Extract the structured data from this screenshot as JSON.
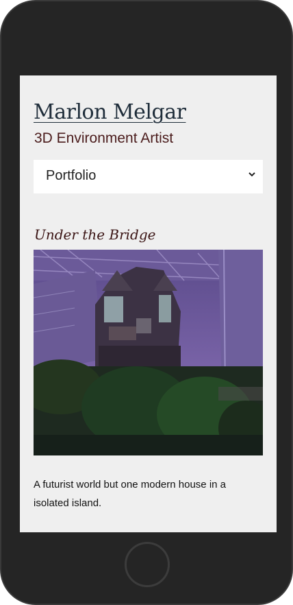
{
  "site": {
    "title": "Marlon Melgar",
    "subtitle": "3D Environment Artist"
  },
  "nav": {
    "selected": "Portfolio",
    "icon": "chevron-down-icon"
  },
  "project": {
    "title": "Under the Bridge",
    "description": "A futurist world but one modern house in a isolated island."
  },
  "colors": {
    "screen_background": "#efefef",
    "title": "#1f2d3a",
    "subtitle": "#4a1b1b",
    "phone_frame": "#252525"
  }
}
